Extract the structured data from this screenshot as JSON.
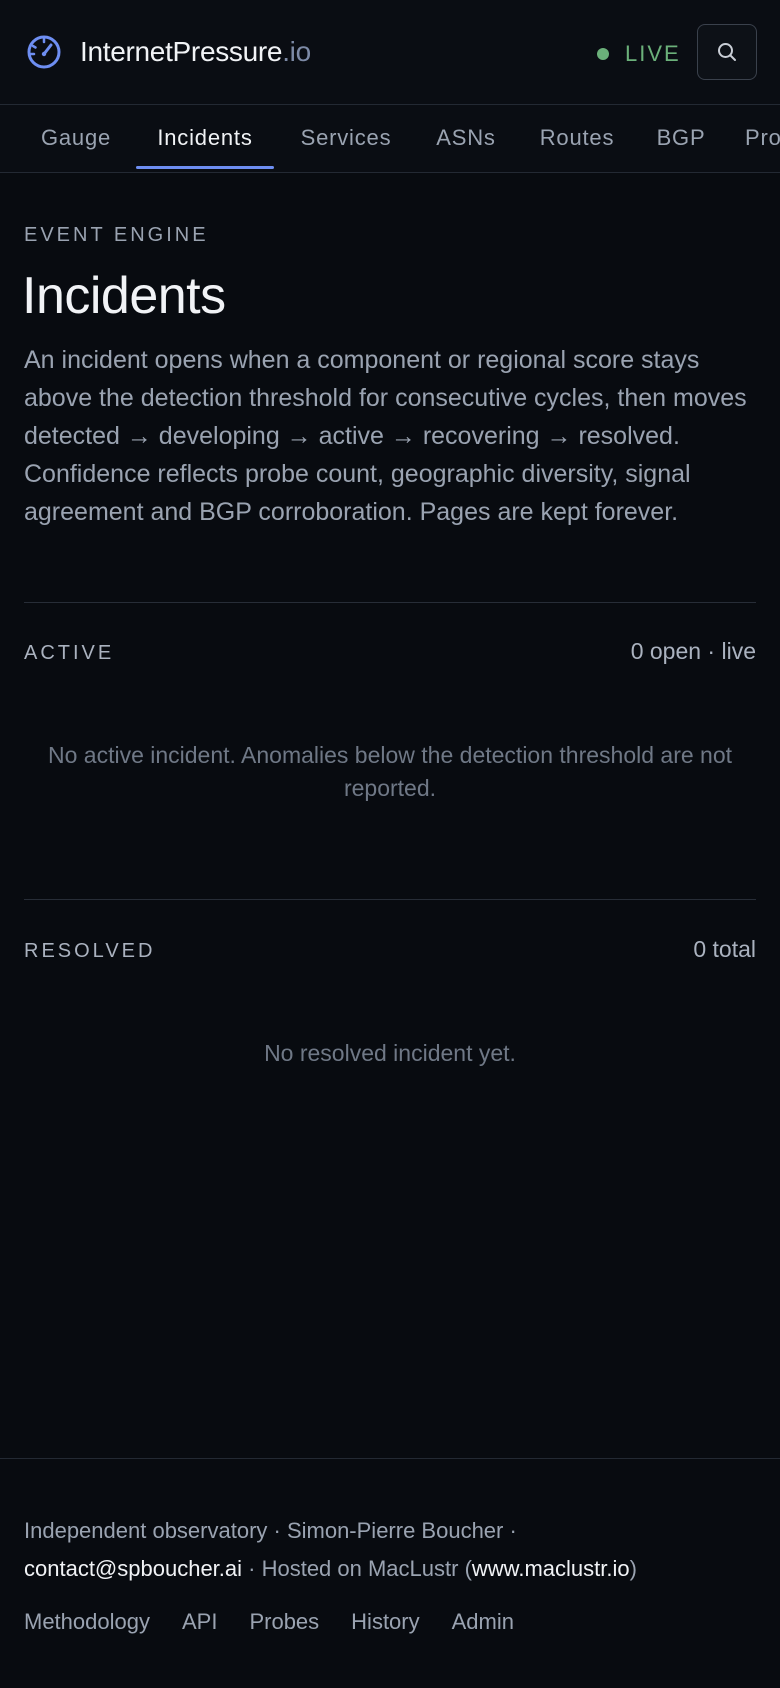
{
  "header": {
    "brand_name": "InternetPressure",
    "brand_tld": ".io",
    "live_label": "LIVE",
    "status_color": "#6bb07a",
    "accent_color": "#6e8ef2",
    "logo_icon": "gauge-icon",
    "search_icon": "search-icon"
  },
  "tabs": [
    {
      "label": "Gauge",
      "active": false
    },
    {
      "label": "Incidents",
      "active": true
    },
    {
      "label": "Services",
      "active": false
    },
    {
      "label": "ASNs",
      "active": false
    },
    {
      "label": "Routes",
      "active": false
    },
    {
      "label": "BGP",
      "active": false
    },
    {
      "label": "Probes",
      "active": false
    }
  ],
  "main": {
    "eyebrow": "EVENT ENGINE",
    "title": "Incidents",
    "intro": "An incident opens when a component or regional score stays above the detection threshold for consecutive cycles, then moves detected → developing → active → recovering → resolved. Confidence reflects probe count, geographic diversity, signal agreement and BGP corroboration. Pages are kept forever.",
    "active": {
      "label": "ACTIVE",
      "meta": "0 open · live",
      "empty": "No active incident. Anomalies below the detection threshold are not reported."
    },
    "resolved": {
      "label": "RESOLVED",
      "meta": "0 total",
      "empty": "No resolved incident yet."
    }
  },
  "footer": {
    "line_1": "Independent observatory · Simon-Pierre Boucher ·",
    "email": "contact@spboucher.ai",
    "hosted_prefix": " · Hosted on MacLustr (",
    "host_link": "www.maclustr.io",
    "hosted_suffix": ")",
    "links": [
      "Methodology",
      "API",
      "Probes",
      "History",
      "Admin"
    ]
  }
}
